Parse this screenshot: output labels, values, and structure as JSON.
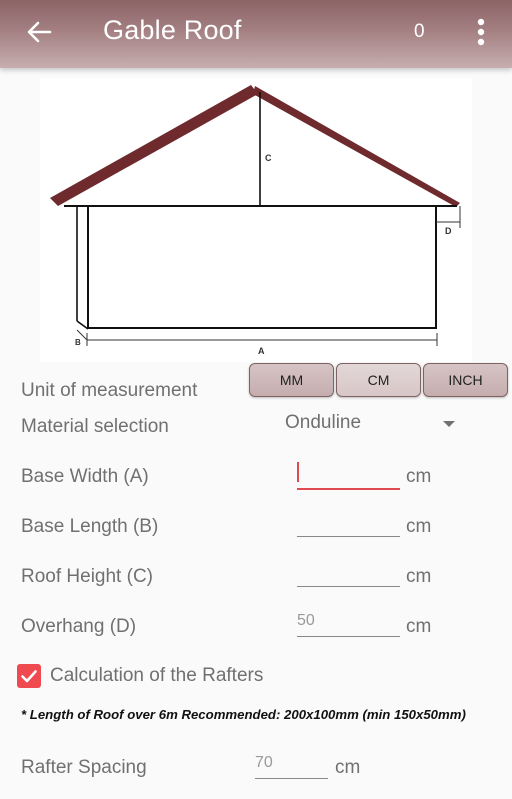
{
  "appbar": {
    "title": "Gable Roof",
    "count": "0",
    "back_icon": "arrow-left-icon",
    "menu_icon": "more-vert-icon"
  },
  "diagram": {
    "labels": {
      "a": "A",
      "b": "B",
      "c": "C",
      "d": "D"
    },
    "roof_color": "#6e2a2c"
  },
  "unit_of_measurement": {
    "label": "Unit of measurement",
    "options": [
      "MM",
      "CM",
      "INCH"
    ],
    "selected": "CM"
  },
  "material": {
    "label": "Material selection",
    "value": "Onduline"
  },
  "fields": [
    {
      "label": "Base Width (A)",
      "value": "",
      "unit": "cm",
      "focused": true
    },
    {
      "label": "Base Length (B)",
      "value": "",
      "unit": "cm"
    },
    {
      "label": "Roof Height (C)",
      "value": "",
      "unit": "cm"
    },
    {
      "label": "Overhang (D)",
      "value": "50",
      "unit": "cm"
    }
  ],
  "rafters": {
    "checkbox_label": "Calculation of the Rafters",
    "checked": true,
    "note": "* Length of Roof over 6m Recommended: 200x100mm (min 150x50mm)",
    "spacing": {
      "label": "Rafter Spacing",
      "value": "70",
      "unit": "cm"
    }
  },
  "colors": {
    "accent": "#ef4a50",
    "appbar": "#a48082"
  }
}
